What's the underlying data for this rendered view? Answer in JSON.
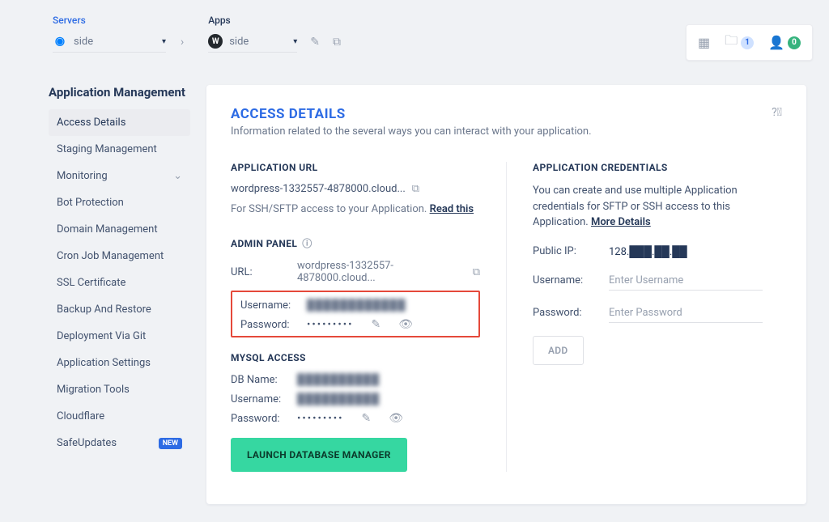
{
  "top": {
    "servers_label": "Servers",
    "server_selected": "side",
    "apps_label": "Apps",
    "app_selected": "side",
    "folder_badge": "1",
    "user_badge": "0"
  },
  "sidebar": {
    "title": "Application Management",
    "items": [
      {
        "label": "Access Details",
        "active": true
      },
      {
        "label": "Staging Management"
      },
      {
        "label": "Monitoring",
        "expandable": true
      },
      {
        "label": "Bot Protection"
      },
      {
        "label": "Domain Management"
      },
      {
        "label": "Cron Job Management"
      },
      {
        "label": "SSL Certificate"
      },
      {
        "label": "Backup And Restore"
      },
      {
        "label": "Deployment Via Git"
      },
      {
        "label": "Application Settings"
      },
      {
        "label": "Migration Tools"
      },
      {
        "label": "Cloudflare"
      },
      {
        "label": "SafeUpdates",
        "new": true
      }
    ],
    "new_label": "NEW"
  },
  "main": {
    "title": "ACCESS DETAILS",
    "subtitle": "Information related to the several ways you can interact with your application.",
    "app_url": {
      "hdr": "APPLICATION URL",
      "value": "wordpress-1332557-4878000.cloud...",
      "note": "For SSH/SFTP access to your Application.",
      "read_this": "Read this"
    },
    "admin": {
      "hdr": "ADMIN PANEL",
      "url_label": "URL:",
      "url_value": "wordpress-1332557-4878000.cloud...",
      "username_label": "Username:",
      "password_label": "Password:",
      "password_dots": "•••••••••"
    },
    "mysql": {
      "hdr": "MYSQL ACCESS",
      "db_label": "DB Name:",
      "user_label": "Username:",
      "pass_label": "Password:",
      "dots": "•••••••••",
      "launch": "LAUNCH DATABASE MANAGER"
    },
    "creds": {
      "hdr": "APPLICATION CREDENTIALS",
      "desc": "You can create and use multiple Application credentials for SFTP or SSH access to this Application.",
      "more": "More Details",
      "ip_label": "Public IP:",
      "ip_value": "128.███.██.██",
      "user_label": "Username:",
      "user_ph": "Enter Username",
      "pass_label": "Password:",
      "pass_ph": "Enter Password",
      "add": "ADD"
    }
  }
}
